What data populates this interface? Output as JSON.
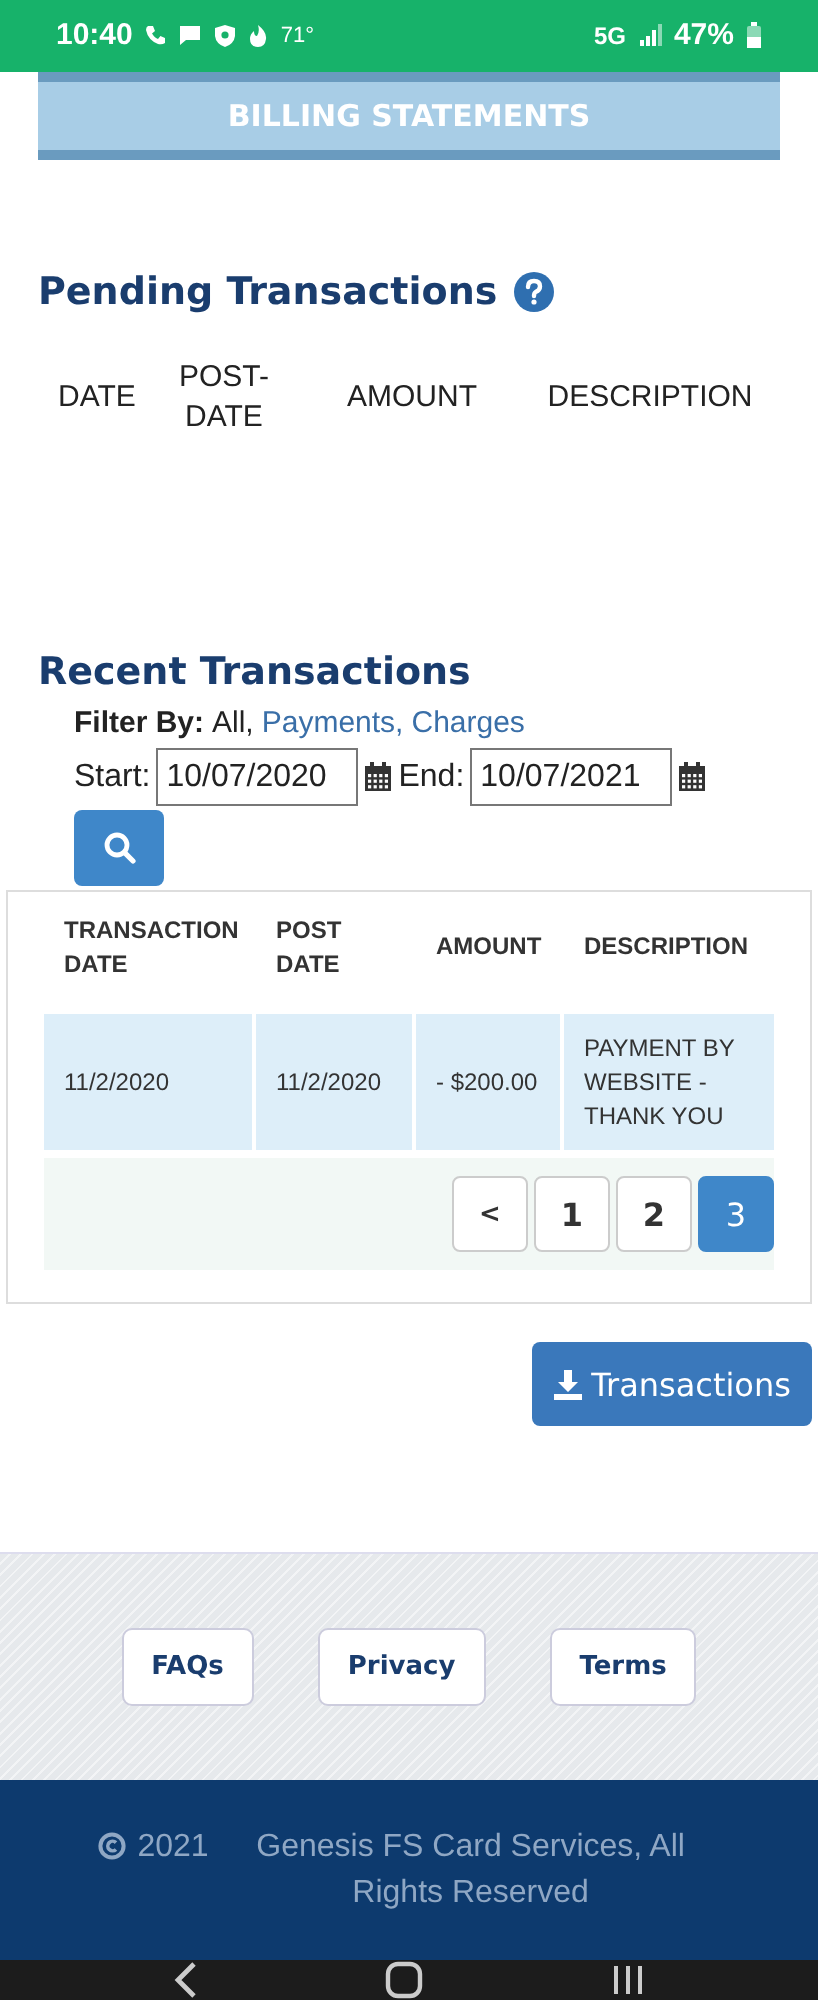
{
  "status_bar": {
    "time": "10:40",
    "temperature": "71°",
    "network": "5G",
    "battery": "47%"
  },
  "billing_button": {
    "label": "BILLING STATEMENTS"
  },
  "pending": {
    "title": "Pending Transactions",
    "columns": [
      "DATE",
      "POST-DATE",
      "AMOUNT",
      "DESCRIPTION"
    ]
  },
  "recent": {
    "title": "Recent Transactions",
    "filter": {
      "label": "Filter By:",
      "options": [
        {
          "label": "All,",
          "selected": true
        },
        {
          "label": "Payments,",
          "selected": false
        },
        {
          "label": "Charges",
          "selected": false
        }
      ]
    },
    "start": {
      "label": "Start:",
      "value": "10/07/2020"
    },
    "end": {
      "label": "End:",
      "value": "10/07/2021"
    },
    "table": {
      "columns": [
        "TRANSACTION DATE",
        "POST DATE",
        "AMOUNT",
        "DESCRIPTION"
      ],
      "rows": [
        [
          "11/2/2020",
          "11/2/2020",
          "- $200.00",
          "PAYMENT BY WEBSITE - THANK YOU"
        ]
      ]
    },
    "pagination": [
      {
        "label": "<",
        "kind": "prev",
        "selected": false
      },
      {
        "label": "1",
        "kind": "page",
        "selected": false
      },
      {
        "label": "2",
        "kind": "page",
        "selected": false
      },
      {
        "label": "3",
        "kind": "page",
        "selected": true
      }
    ],
    "download_button": {
      "label": "Transactions"
    }
  },
  "footer": {
    "links": [
      "FAQs",
      "Privacy",
      "Terms"
    ],
    "copyright_year": "2021",
    "copyright_text": "Genesis FS Card Services, All Rights Reserved"
  }
}
